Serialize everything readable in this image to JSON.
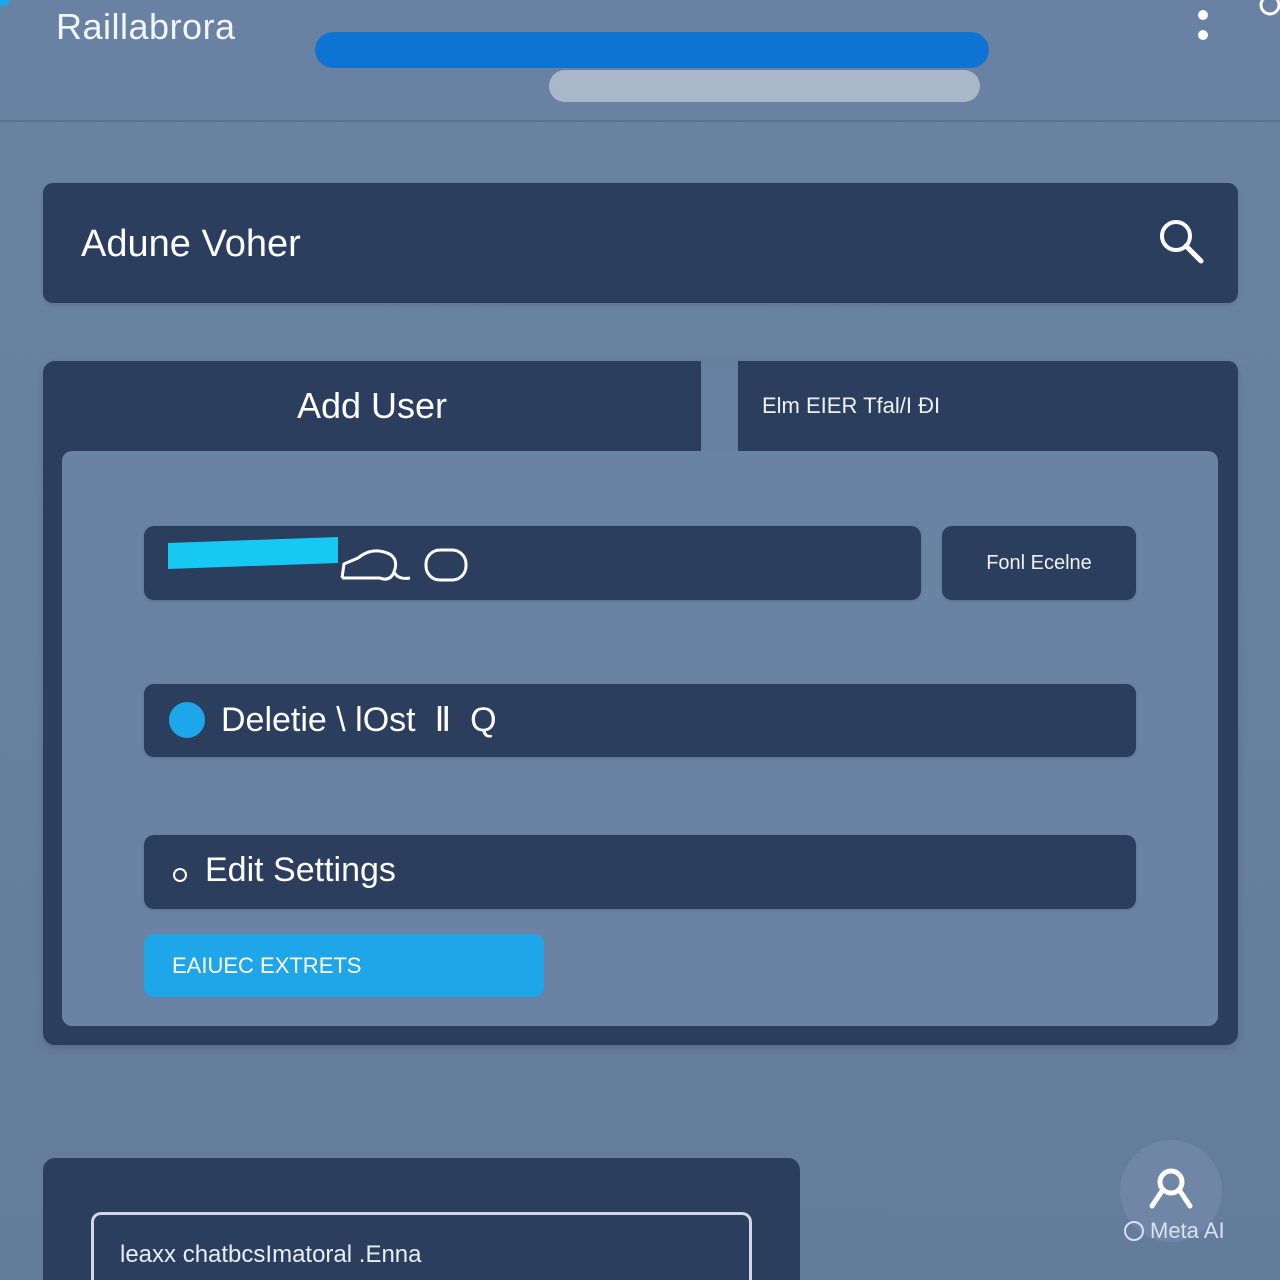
{
  "header": {
    "title": "Raillabrora",
    "progress_primary": 1.0,
    "progress_secondary": 1.0
  },
  "search": {
    "text": "Adune Voher",
    "icon": "search-icon"
  },
  "tabs": {
    "add_user": "Add User",
    "other": "Elm EIER Tfal/I ÐI"
  },
  "form": {
    "tool_button": "Fonl Ecelne",
    "delete_option": "Deletie \\ lOst  Ⅱ  Q",
    "edit_option": "Edit Settings",
    "primary_button": "EAIUEC EXTRETS"
  },
  "bottom": {
    "field_text": "leaxx chatbcsImatoral .Enna"
  },
  "watermark": {
    "text": "Meta AI"
  },
  "colors": {
    "background": "#6982a3",
    "panel": "#2c3e5e",
    "accent_blue": "#0d74d4",
    "accent_cyan": "#1fa6e8",
    "input_cyan": "#16c8f2"
  }
}
